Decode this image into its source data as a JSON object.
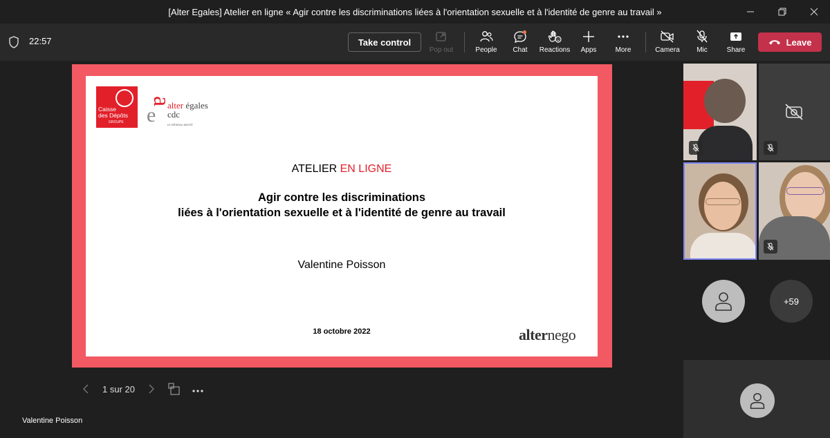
{
  "window": {
    "title": "[Alter Egales] Atelier en ligne « Agir contre les discriminations liées à l'orientation sexuelle et à l'identité de genre au travail »"
  },
  "toolbar": {
    "time": "22:57",
    "take_control": "Take control",
    "pop_out": "Pop out",
    "people": "People",
    "chat": "Chat",
    "reactions": "Reactions",
    "apps": "Apps",
    "more": "More",
    "camera": "Camera",
    "mic": "Mic",
    "share": "Share",
    "leave": "Leave"
  },
  "slide": {
    "logo_cdc_line1": "Caisse",
    "logo_cdc_line2": "des Dépôts",
    "logo_cdc_line3": "GROUPE",
    "logo_alter": "alter",
    "logo_egales": "égales",
    "logo_cdc": "cdc",
    "logo_reseau": "LE RÉSEAU MIXITÉ",
    "atelier": "ATELIER",
    "en_ligne": "EN LIGNE",
    "headline_line1": "Agir contre les discriminations",
    "headline_line2": "liées à l'orientation sexuelle et à l'identité de genre au travail",
    "speaker": "Valentine Poisson",
    "date": "18 octobre 2022",
    "brand_alter": "alter",
    "brand_nego": "nego"
  },
  "slide_nav": {
    "page": "1 sur 20"
  },
  "presenter_name": "Valentine Poisson",
  "participants": {
    "overflow_count": "+59"
  },
  "colors": {
    "slide_border": "#f25962",
    "cdc_red": "#e2202a",
    "leave_red": "#c4314b",
    "active_speaker": "#7f85f5"
  }
}
